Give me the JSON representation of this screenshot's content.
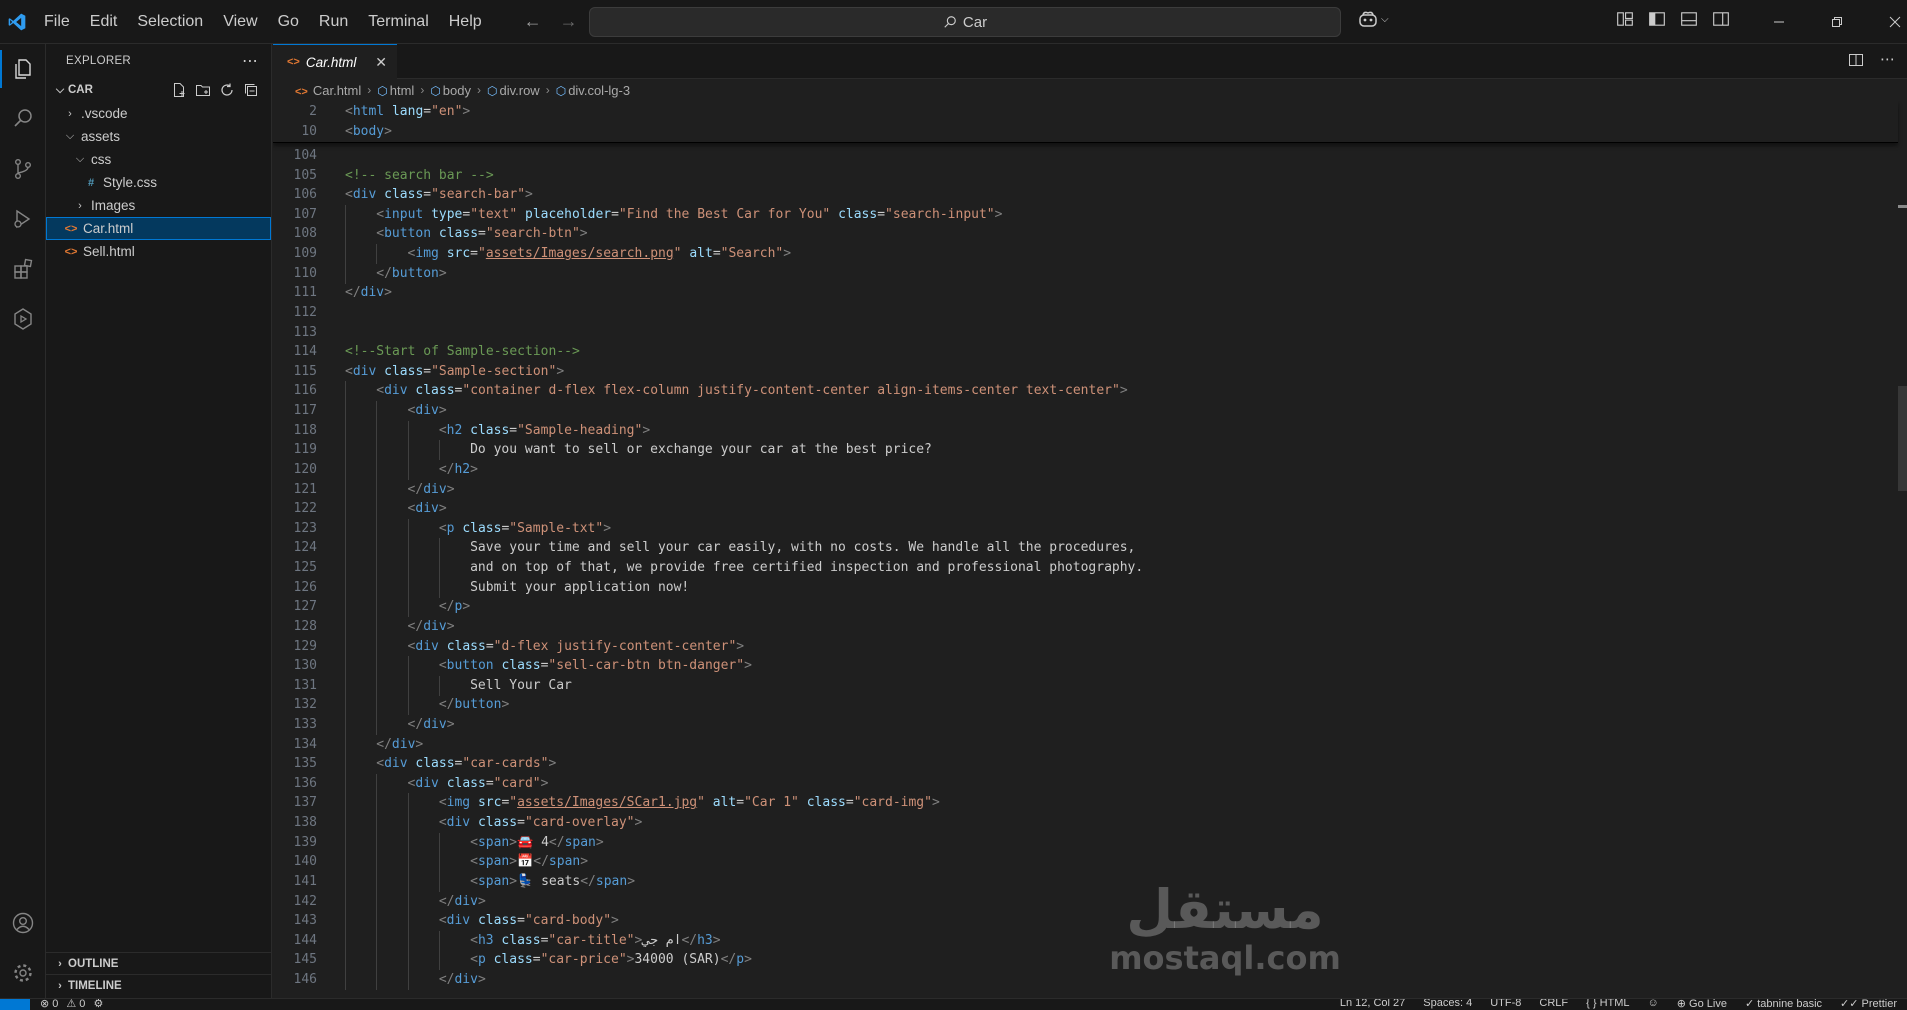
{
  "menu": [
    "File",
    "Edit",
    "Selection",
    "View",
    "Go",
    "Run",
    "Terminal",
    "Help"
  ],
  "command_center": {
    "text": "Car",
    "icon": "search-icon"
  },
  "colors": {
    "accent": "#0078d4",
    "background": "#1f1f1f",
    "sidebar": "#181818",
    "selection": "#04395e"
  },
  "explorer": {
    "title": "EXPLORER",
    "folder": "CAR",
    "tree": [
      {
        "label": ".vscode",
        "type": "folder",
        "expanded": false,
        "depth": 1
      },
      {
        "label": "assets",
        "type": "folder",
        "expanded": true,
        "depth": 1
      },
      {
        "label": "css",
        "type": "folder",
        "expanded": true,
        "depth": 2
      },
      {
        "label": "Style.css",
        "type": "css",
        "depth": 3,
        "icon_text": "#"
      },
      {
        "label": "Images",
        "type": "folder",
        "expanded": false,
        "depth": 2
      },
      {
        "label": "Car.html",
        "type": "html",
        "depth": 1,
        "selected": true,
        "icon_text": "<>"
      },
      {
        "label": "Sell.html",
        "type": "html",
        "depth": 1,
        "icon_text": "<>"
      }
    ],
    "outline": "OUTLINE",
    "timeline": "TIMELINE"
  },
  "tab": {
    "label": "Car.html",
    "icon_text": "<>",
    "close": "✕"
  },
  "breadcrumb": [
    "Car.html",
    "html",
    "body",
    "div.row",
    "div.col-lg-3"
  ],
  "sticky_lines": [
    {
      "n": "2",
      "tokens": [
        [
          "t",
          "<"
        ],
        [
          "tn",
          "html"
        ],
        [
          "tx",
          " "
        ],
        [
          "an",
          "lang"
        ],
        [
          "tx",
          "="
        ],
        [
          "av",
          "\"en\""
        ],
        [
          "t",
          ">"
        ]
      ]
    },
    {
      "n": "10",
      "tokens": [
        [
          "t",
          "<"
        ],
        [
          "tn",
          "body"
        ],
        [
          "t",
          ">"
        ]
      ]
    }
  ],
  "code_lines": [
    {
      "n": "104",
      "indent": 0,
      "tokens": []
    },
    {
      "n": "105",
      "indent": 0,
      "tokens": [
        [
          "cm",
          "<!-- search bar -->"
        ]
      ]
    },
    {
      "n": "106",
      "indent": 0,
      "tokens": [
        [
          "t",
          "<"
        ],
        [
          "tn",
          "div"
        ],
        [
          "tx",
          " "
        ],
        [
          "an",
          "class"
        ],
        [
          "tx",
          "="
        ],
        [
          "av",
          "\"search-bar\""
        ],
        [
          "t",
          ">"
        ]
      ]
    },
    {
      "n": "107",
      "indent": 1,
      "tokens": [
        [
          "t",
          "<"
        ],
        [
          "tn",
          "input"
        ],
        [
          "tx",
          " "
        ],
        [
          "an",
          "type"
        ],
        [
          "tx",
          "="
        ],
        [
          "av",
          "\"text\""
        ],
        [
          "tx",
          " "
        ],
        [
          "an",
          "placeholder"
        ],
        [
          "tx",
          "="
        ],
        [
          "av",
          "\"Find the Best Car for You\""
        ],
        [
          "tx",
          " "
        ],
        [
          "an",
          "class"
        ],
        [
          "tx",
          "="
        ],
        [
          "av",
          "\"search-input\""
        ],
        [
          "t",
          ">"
        ]
      ]
    },
    {
      "n": "108",
      "indent": 1,
      "tokens": [
        [
          "t",
          "<"
        ],
        [
          "tn",
          "button"
        ],
        [
          "tx",
          " "
        ],
        [
          "an",
          "class"
        ],
        [
          "tx",
          "="
        ],
        [
          "av",
          "\"search-btn\""
        ],
        [
          "t",
          ">"
        ]
      ]
    },
    {
      "n": "109",
      "indent": 2,
      "tokens": [
        [
          "t",
          "<"
        ],
        [
          "tn",
          "img"
        ],
        [
          "tx",
          " "
        ],
        [
          "an",
          "src"
        ],
        [
          "tx",
          "="
        ],
        [
          "av",
          "\""
        ],
        [
          "avu",
          "assets/Images/search.png"
        ],
        [
          "av",
          "\""
        ],
        [
          "tx",
          " "
        ],
        [
          "an",
          "alt"
        ],
        [
          "tx",
          "="
        ],
        [
          "av",
          "\"Search\""
        ],
        [
          "t",
          ">"
        ]
      ]
    },
    {
      "n": "110",
      "indent": 1,
      "tokens": [
        [
          "t",
          "</"
        ],
        [
          "tn",
          "button"
        ],
        [
          "t",
          ">"
        ]
      ]
    },
    {
      "n": "111",
      "indent": 0,
      "tokens": [
        [
          "t",
          "</"
        ],
        [
          "tn",
          "div"
        ],
        [
          "t",
          ">"
        ]
      ]
    },
    {
      "n": "112",
      "indent": 0,
      "tokens": []
    },
    {
      "n": "113",
      "indent": 0,
      "tokens": []
    },
    {
      "n": "114",
      "indent": 0,
      "tokens": [
        [
          "cm",
          "<!--Start of Sample-section-->"
        ]
      ]
    },
    {
      "n": "115",
      "indent": 0,
      "tokens": [
        [
          "t",
          "<"
        ],
        [
          "tn",
          "div"
        ],
        [
          "tx",
          " "
        ],
        [
          "an",
          "class"
        ],
        [
          "tx",
          "="
        ],
        [
          "av",
          "\"Sample-section\""
        ],
        [
          "t",
          ">"
        ]
      ]
    },
    {
      "n": "116",
      "indent": 1,
      "tokens": [
        [
          "t",
          "<"
        ],
        [
          "tn",
          "div"
        ],
        [
          "tx",
          " "
        ],
        [
          "an",
          "class"
        ],
        [
          "tx",
          "="
        ],
        [
          "av",
          "\"container d-flex flex-column justify-content-center align-items-center text-center\""
        ],
        [
          "t",
          ">"
        ]
      ]
    },
    {
      "n": "117",
      "indent": 2,
      "tokens": [
        [
          "t",
          "<"
        ],
        [
          "tn",
          "div"
        ],
        [
          "t",
          ">"
        ]
      ]
    },
    {
      "n": "118",
      "indent": 3,
      "tokens": [
        [
          "t",
          "<"
        ],
        [
          "tn",
          "h2"
        ],
        [
          "tx",
          " "
        ],
        [
          "an",
          "class"
        ],
        [
          "tx",
          "="
        ],
        [
          "av",
          "\"Sample-heading\""
        ],
        [
          "t",
          ">"
        ]
      ]
    },
    {
      "n": "119",
      "indent": 4,
      "tokens": [
        [
          "tx",
          "Do you want to sell or exchange your car at the best price?"
        ]
      ]
    },
    {
      "n": "120",
      "indent": 3,
      "tokens": [
        [
          "t",
          "</"
        ],
        [
          "tn",
          "h2"
        ],
        [
          "t",
          ">"
        ]
      ]
    },
    {
      "n": "121",
      "indent": 2,
      "tokens": [
        [
          "t",
          "</"
        ],
        [
          "tn",
          "div"
        ],
        [
          "t",
          ">"
        ]
      ]
    },
    {
      "n": "122",
      "indent": 2,
      "tokens": [
        [
          "t",
          "<"
        ],
        [
          "tn",
          "div"
        ],
        [
          "t",
          ">"
        ]
      ]
    },
    {
      "n": "123",
      "indent": 3,
      "tokens": [
        [
          "t",
          "<"
        ],
        [
          "tn",
          "p"
        ],
        [
          "tx",
          " "
        ],
        [
          "an",
          "class"
        ],
        [
          "tx",
          "="
        ],
        [
          "av",
          "\"Sample-txt\""
        ],
        [
          "t",
          ">"
        ]
      ]
    },
    {
      "n": "124",
      "indent": 4,
      "tokens": [
        [
          "tx",
          "Save your time and sell your car easily, with no costs. We handle all the procedures,"
        ]
      ]
    },
    {
      "n": "125",
      "indent": 4,
      "tokens": [
        [
          "tx",
          "and on top of that, we provide free certified inspection and professional photography."
        ]
      ]
    },
    {
      "n": "126",
      "indent": 4,
      "tokens": [
        [
          "tx",
          "Submit your application now!"
        ]
      ]
    },
    {
      "n": "127",
      "indent": 3,
      "tokens": [
        [
          "t",
          "</"
        ],
        [
          "tn",
          "p"
        ],
        [
          "t",
          ">"
        ]
      ]
    },
    {
      "n": "128",
      "indent": 2,
      "tokens": [
        [
          "t",
          "</"
        ],
        [
          "tn",
          "div"
        ],
        [
          "t",
          ">"
        ]
      ]
    },
    {
      "n": "129",
      "indent": 2,
      "tokens": [
        [
          "t",
          "<"
        ],
        [
          "tn",
          "div"
        ],
        [
          "tx",
          " "
        ],
        [
          "an",
          "class"
        ],
        [
          "tx",
          "="
        ],
        [
          "av",
          "\"d-flex justify-content-center\""
        ],
        [
          "t",
          ">"
        ]
      ]
    },
    {
      "n": "130",
      "indent": 3,
      "tokens": [
        [
          "t",
          "<"
        ],
        [
          "tn",
          "button"
        ],
        [
          "tx",
          " "
        ],
        [
          "an",
          "class"
        ],
        [
          "tx",
          "="
        ],
        [
          "av",
          "\"sell-car-btn btn-danger\""
        ],
        [
          "t",
          ">"
        ]
      ]
    },
    {
      "n": "131",
      "indent": 4,
      "tokens": [
        [
          "tx",
          "Sell Your Car"
        ]
      ]
    },
    {
      "n": "132",
      "indent": 3,
      "tokens": [
        [
          "t",
          "</"
        ],
        [
          "tn",
          "button"
        ],
        [
          "t",
          ">"
        ]
      ]
    },
    {
      "n": "133",
      "indent": 2,
      "tokens": [
        [
          "t",
          "</"
        ],
        [
          "tn",
          "div"
        ],
        [
          "t",
          ">"
        ]
      ]
    },
    {
      "n": "134",
      "indent": 1,
      "tokens": [
        [
          "t",
          "</"
        ],
        [
          "tn",
          "div"
        ],
        [
          "t",
          ">"
        ]
      ]
    },
    {
      "n": "135",
      "indent": 1,
      "tokens": [
        [
          "t",
          "<"
        ],
        [
          "tn",
          "div"
        ],
        [
          "tx",
          " "
        ],
        [
          "an",
          "class"
        ],
        [
          "tx",
          "="
        ],
        [
          "av",
          "\"car-cards\""
        ],
        [
          "t",
          ">"
        ]
      ]
    },
    {
      "n": "136",
      "indent": 2,
      "tokens": [
        [
          "t",
          "<"
        ],
        [
          "tn",
          "div"
        ],
        [
          "tx",
          " "
        ],
        [
          "an",
          "class"
        ],
        [
          "tx",
          "="
        ],
        [
          "av",
          "\"card\""
        ],
        [
          "t",
          ">"
        ]
      ]
    },
    {
      "n": "137",
      "indent": 3,
      "tokens": [
        [
          "t",
          "<"
        ],
        [
          "tn",
          "img"
        ],
        [
          "tx",
          " "
        ],
        [
          "an",
          "src"
        ],
        [
          "tx",
          "="
        ],
        [
          "av",
          "\""
        ],
        [
          "avu",
          "assets/Images/SCar1.jpg"
        ],
        [
          "av",
          "\""
        ],
        [
          "tx",
          " "
        ],
        [
          "an",
          "alt"
        ],
        [
          "tx",
          "="
        ],
        [
          "av",
          "\"Car 1\""
        ],
        [
          "tx",
          " "
        ],
        [
          "an",
          "class"
        ],
        [
          "tx",
          "="
        ],
        [
          "av",
          "\"card-img\""
        ],
        [
          "t",
          ">"
        ]
      ]
    },
    {
      "n": "138",
      "indent": 3,
      "tokens": [
        [
          "t",
          "<"
        ],
        [
          "tn",
          "div"
        ],
        [
          "tx",
          " "
        ],
        [
          "an",
          "class"
        ],
        [
          "tx",
          "="
        ],
        [
          "av",
          "\"card-overlay\""
        ],
        [
          "t",
          ">"
        ]
      ]
    },
    {
      "n": "139",
      "indent": 4,
      "tokens": [
        [
          "t",
          "<"
        ],
        [
          "tn",
          "span"
        ],
        [
          "t",
          ">"
        ],
        [
          "tx",
          "🚘 4"
        ],
        [
          "t",
          "</"
        ],
        [
          "tn",
          "span"
        ],
        [
          "t",
          ">"
        ]
      ]
    },
    {
      "n": "140",
      "indent": 4,
      "tokens": [
        [
          "t",
          "<"
        ],
        [
          "tn",
          "span"
        ],
        [
          "t",
          ">"
        ],
        [
          "tx",
          "📅"
        ],
        [
          "t",
          "</"
        ],
        [
          "tn",
          "span"
        ],
        [
          "t",
          ">"
        ]
      ]
    },
    {
      "n": "141",
      "indent": 4,
      "tokens": [
        [
          "t",
          "<"
        ],
        [
          "tn",
          "span"
        ],
        [
          "t",
          ">"
        ],
        [
          "tx",
          "💺 seats"
        ],
        [
          "t",
          "</"
        ],
        [
          "tn",
          "span"
        ],
        [
          "t",
          ">"
        ]
      ]
    },
    {
      "n": "142",
      "indent": 3,
      "tokens": [
        [
          "t",
          "</"
        ],
        [
          "tn",
          "div"
        ],
        [
          "t",
          ">"
        ]
      ]
    },
    {
      "n": "143",
      "indent": 3,
      "tokens": [
        [
          "t",
          "<"
        ],
        [
          "tn",
          "div"
        ],
        [
          "tx",
          " "
        ],
        [
          "an",
          "class"
        ],
        [
          "tx",
          "="
        ],
        [
          "av",
          "\"card-body\""
        ],
        [
          "t",
          ">"
        ]
      ]
    },
    {
      "n": "144",
      "indent": 4,
      "tokens": [
        [
          "t",
          "<"
        ],
        [
          "tn",
          "h3"
        ],
        [
          "tx",
          " "
        ],
        [
          "an",
          "class"
        ],
        [
          "tx",
          "="
        ],
        [
          "av",
          "\"car-title\""
        ],
        [
          "t",
          ">"
        ],
        [
          "tx",
          "ام جي"
        ],
        [
          "t",
          "</"
        ],
        [
          "tn",
          "h3"
        ],
        [
          "t",
          ">"
        ]
      ]
    },
    {
      "n": "145",
      "indent": 4,
      "tokens": [
        [
          "t",
          "<"
        ],
        [
          "tn",
          "p"
        ],
        [
          "tx",
          " "
        ],
        [
          "an",
          "class"
        ],
        [
          "tx",
          "="
        ],
        [
          "av",
          "\"car-price\""
        ],
        [
          "t",
          ">"
        ],
        [
          "tx",
          "34000 (SAR)"
        ],
        [
          "t",
          "</"
        ],
        [
          "tn",
          "p"
        ],
        [
          "t",
          ">"
        ]
      ]
    },
    {
      "n": "146",
      "indent": 3,
      "tokens": [
        [
          "t",
          "</"
        ],
        [
          "tn",
          "div"
        ],
        [
          "t",
          ">"
        ]
      ]
    }
  ],
  "watermark": {
    "arabic": "مستقل",
    "latin": "mostaql.com"
  },
  "status": {
    "left": [
      "⊗ 0",
      "⚠ 0",
      "⚙"
    ],
    "right": [
      "Ln 12, Col 27",
      "Spaces: 4",
      "UTF-8",
      "CRLF",
      "{ } HTML",
      "☺",
      "⊕ Go Live",
      "✓ tabnine basic",
      "✓✓ Prettier"
    ]
  }
}
